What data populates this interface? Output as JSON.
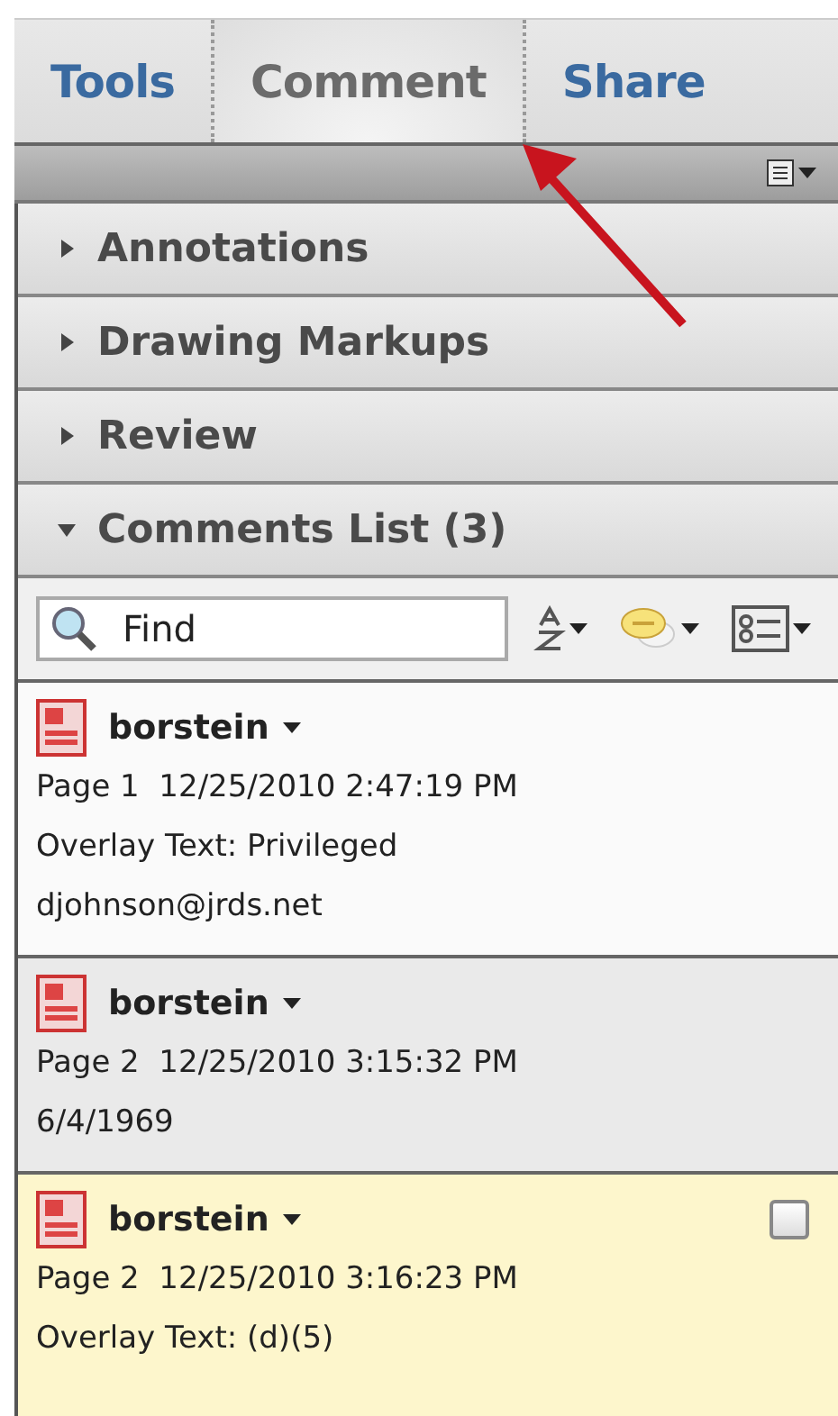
{
  "tabs": [
    {
      "label": "Tools",
      "selected": false
    },
    {
      "label": "Comment",
      "selected": true
    },
    {
      "label": "Share",
      "selected": false
    }
  ],
  "sections": [
    {
      "label": "Annotations",
      "expanded": false
    },
    {
      "label": "Drawing Markups",
      "expanded": false
    },
    {
      "label": "Review",
      "expanded": false
    },
    {
      "label": "Comments List (3)",
      "expanded": true
    }
  ],
  "search": {
    "placeholder": "Find"
  },
  "comments": [
    {
      "author": "borstein",
      "meta": "Page 1  12/25/2010 2:47:19 PM",
      "lines": [
        "Overlay Text: Privileged",
        "djohnson@jrds.net"
      ],
      "selected": false,
      "highlighted": false
    },
    {
      "author": "borstein",
      "meta": "Page 2  12/25/2010 3:15:32 PM",
      "lines": [
        "6/4/1969"
      ],
      "selected": false,
      "highlighted": true
    },
    {
      "author": "borstein",
      "meta": "Page 2  12/25/2010 3:16:23 PM",
      "lines": [
        "Overlay Text: (d)(5)"
      ],
      "selected": true,
      "highlighted": false,
      "checkbox": {
        "checked": false
      }
    }
  ]
}
